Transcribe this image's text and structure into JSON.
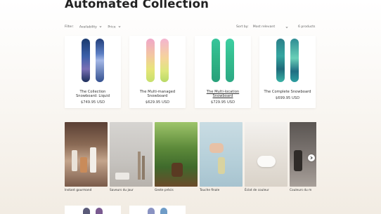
{
  "page": {
    "title": "Automated Collection"
  },
  "filters": {
    "label": "Filter:",
    "availability": "Availability",
    "price": "Price"
  },
  "sort": {
    "label": "Sort by:",
    "value": "Most relevant"
  },
  "count": "6 products",
  "products": [
    {
      "title": "The Collection Snowboard: Liquid",
      "price": "$749.95 USD"
    },
    {
      "title": "The Multi-managed Snowboard",
      "price": "$629.95 USD"
    },
    {
      "title": "The Multi-location Snowboard",
      "price": "$729.95 USD"
    },
    {
      "title": "The Complete Snowboard",
      "price": "$699.95 USD"
    }
  ],
  "tiles": [
    {
      "label": "Instant gourmand"
    },
    {
      "label": "Saveurs du jour"
    },
    {
      "label": "Geste précis"
    },
    {
      "label": "Touche finale"
    },
    {
      "label": "Éclat de couleur"
    },
    {
      "label": "Couleurs du m"
    }
  ],
  "colors": {
    "accent": "#1f1f1f",
    "background": "#f6f2ec"
  }
}
